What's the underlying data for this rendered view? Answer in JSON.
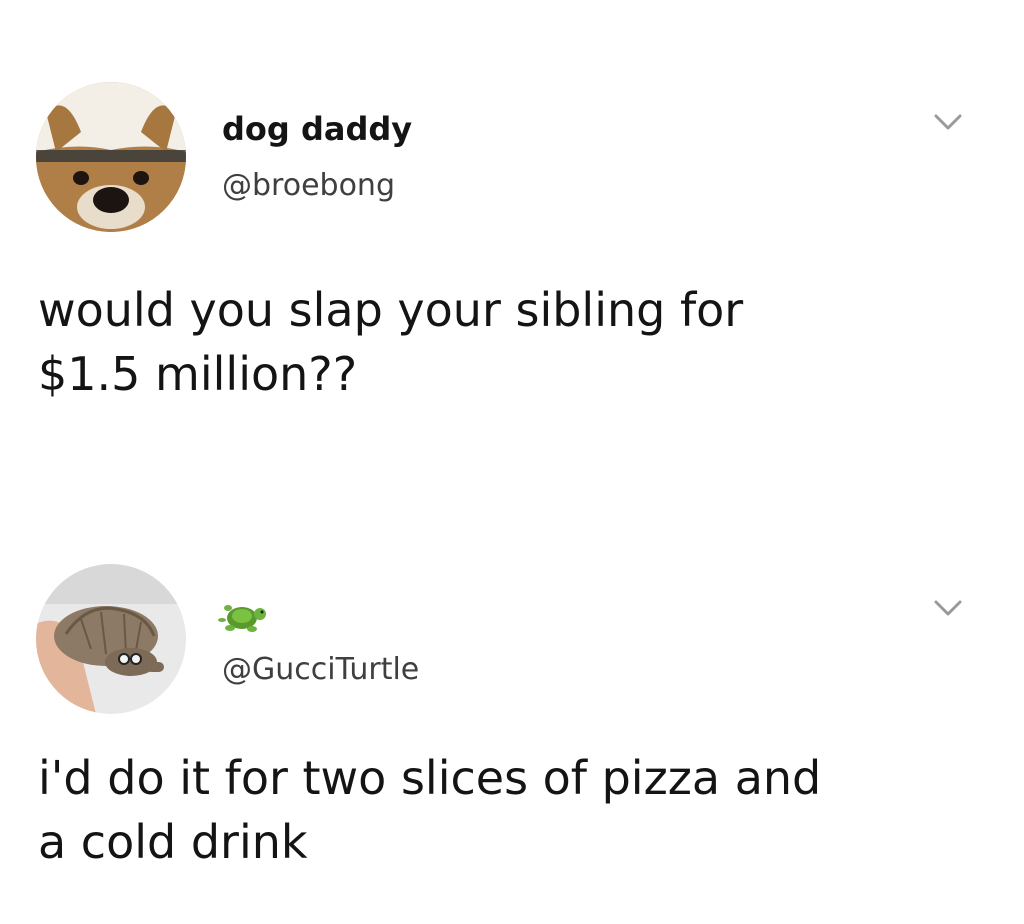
{
  "tweets": [
    {
      "display_name": "dog daddy",
      "handle": "@broebong",
      "text": "would you slap your sibling for\n$1.5 million??",
      "avatar_icon": "dog-photo-avatar",
      "menu_icon": "chevron-down-icon"
    },
    {
      "display_name_icon": "turtle-emoji",
      "handle": "@GucciTurtle",
      "text": "i'd do it for two slices of pizza and\na cold drink",
      "avatar_icon": "turtle-photo-avatar",
      "menu_icon": "chevron-down-icon"
    }
  ],
  "colors": {
    "background": "#ffffff",
    "text": "#141414",
    "handle": "#3f3f3f",
    "chevron": "#9a9a9a"
  }
}
